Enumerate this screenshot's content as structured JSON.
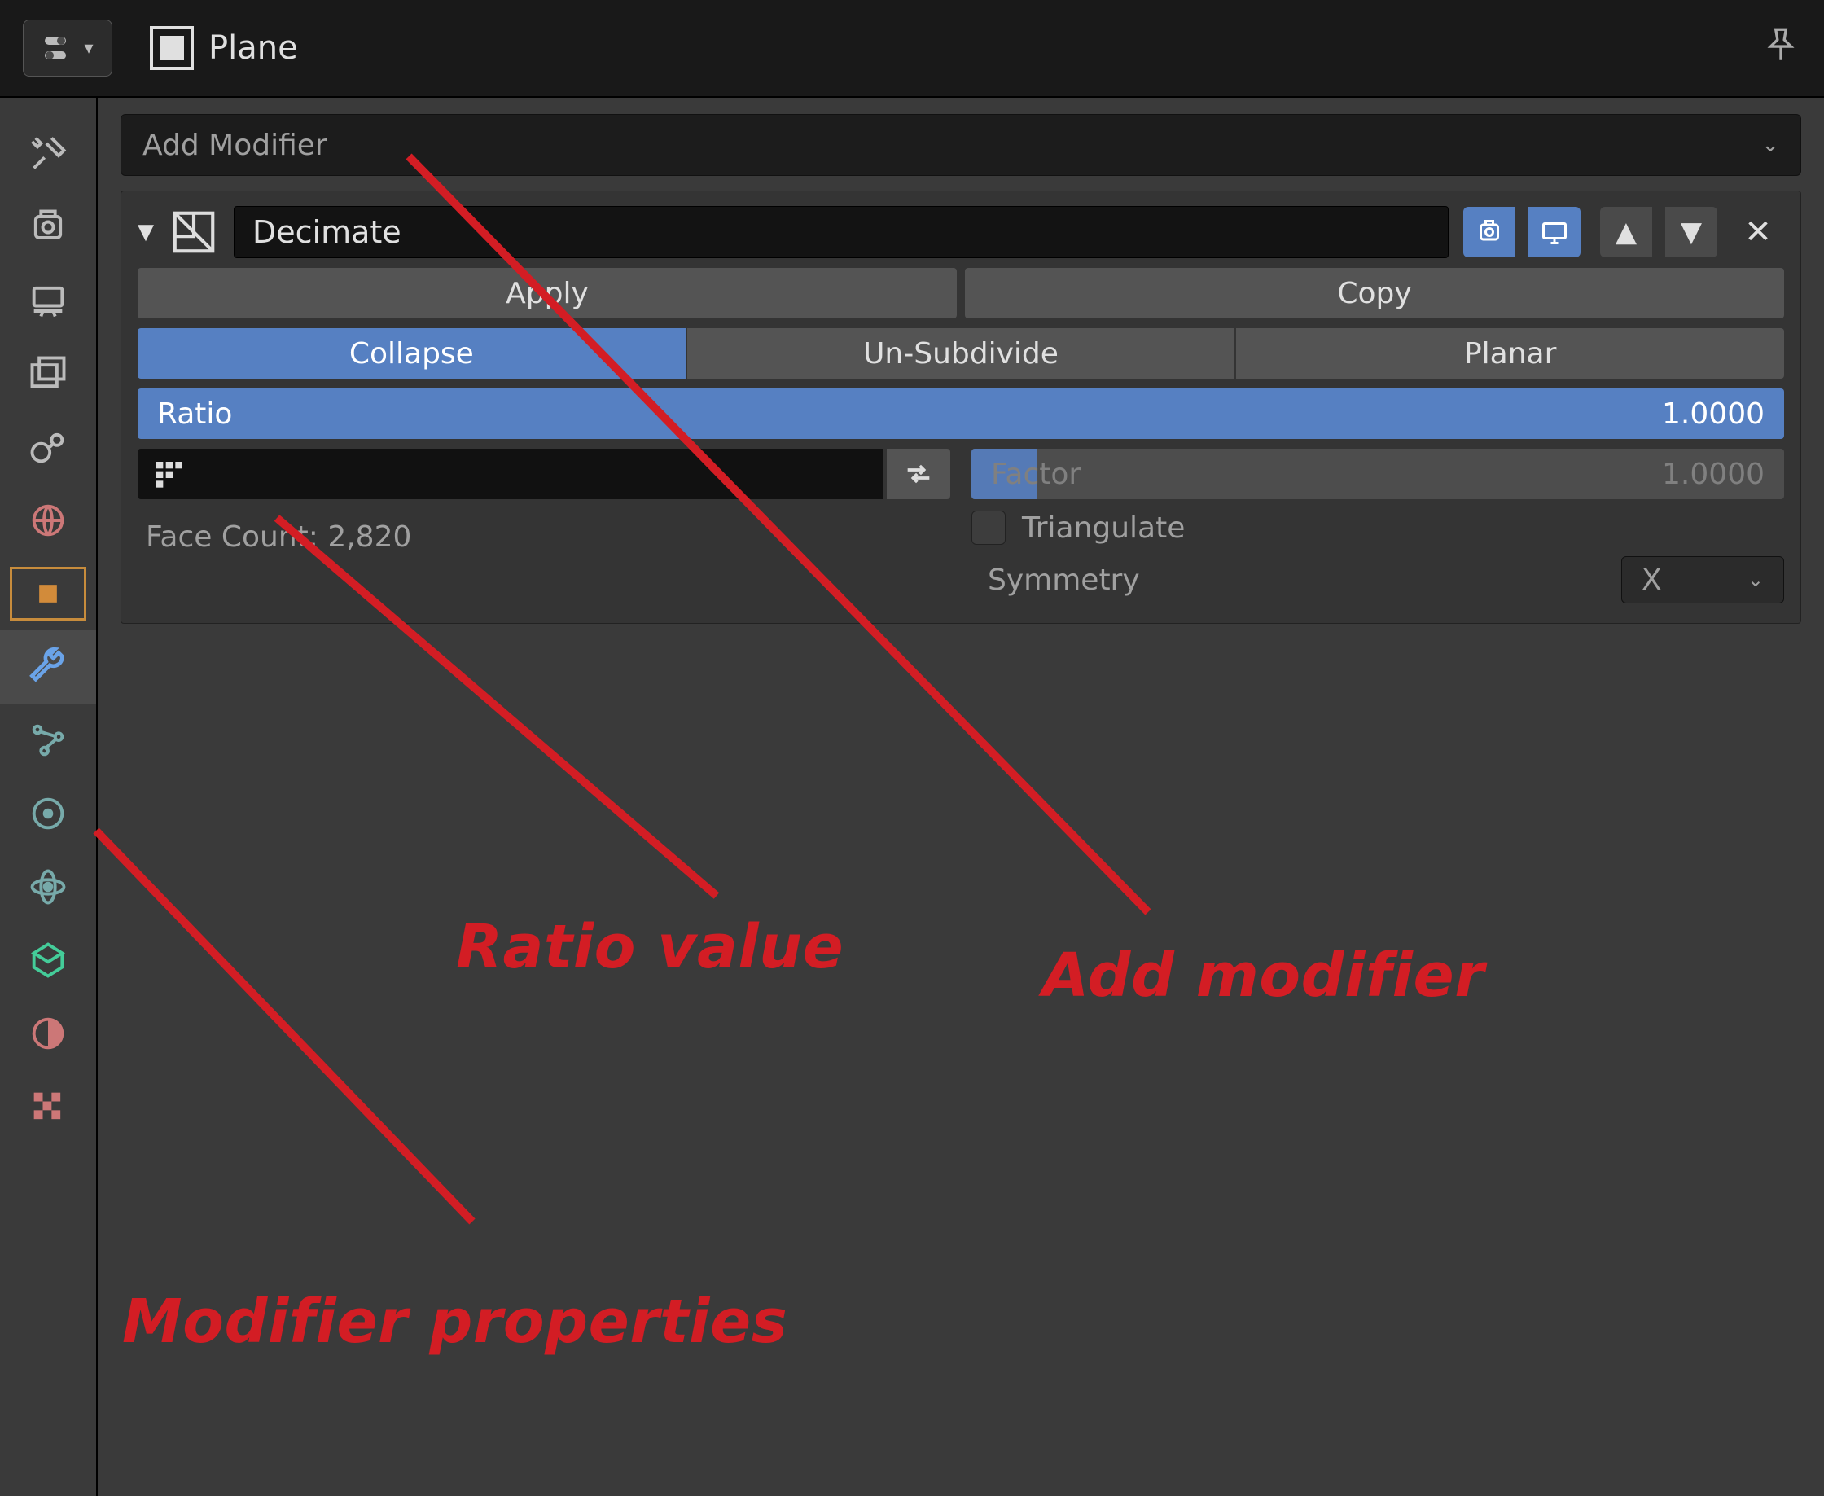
{
  "header": {
    "object_name": "Plane"
  },
  "add_modifier_label": "Add Modifier",
  "modifier": {
    "name": "Decimate",
    "apply_label": "Apply",
    "copy_label": "Copy",
    "modes": [
      "Collapse",
      "Un-Subdivide",
      "Planar"
    ],
    "active_mode_index": 0,
    "ratio_label": "Ratio",
    "ratio_value": "1.0000",
    "factor_label": "Factor",
    "factor_value": "1.0000",
    "face_count_label": "Face Count: 2,820",
    "triangulate_label": "Triangulate",
    "symmetry_label": "Symmetry",
    "symmetry_axis": "X"
  },
  "annotations": {
    "ratio": "Ratio value",
    "add_modifier": "Add modifier",
    "modifier_properties": "Modifier properties"
  }
}
